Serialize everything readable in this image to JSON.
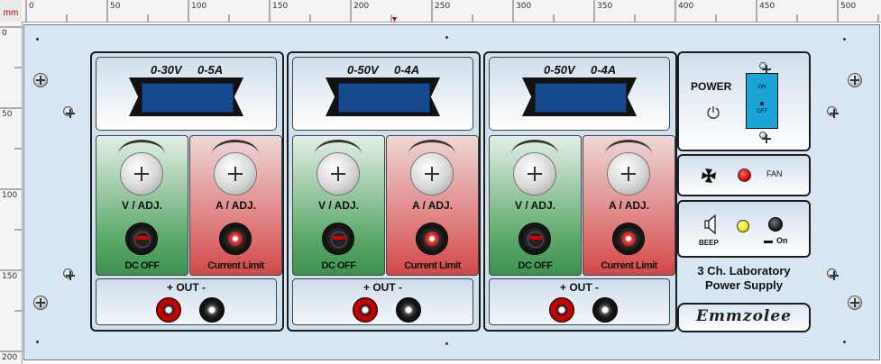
{
  "ruler": {
    "unit": "mm",
    "top_ticks": [
      "0",
      "50",
      "100",
      "150",
      "200",
      "250",
      "300",
      "350",
      "400",
      "450",
      "500"
    ],
    "left_ticks": [
      "0",
      "50",
      "100",
      "150",
      "200"
    ]
  },
  "channels": [
    {
      "voltage": "0-30V",
      "current": "0-5A",
      "v_knob": "V / ADJ.",
      "a_knob": "A / ADJ.",
      "dc_off": "DC OFF",
      "current_limit": "Current Limit",
      "out": "+ OUT -"
    },
    {
      "voltage": "0-50V",
      "current": "0-4A",
      "v_knob": "V / ADJ.",
      "a_knob": "A / ADJ.",
      "dc_off": "DC OFF",
      "current_limit": "Current Limit",
      "out": "+ OUT -"
    },
    {
      "voltage": "0-50V",
      "current": "0-4A",
      "v_knob": "V / ADJ.",
      "a_knob": "A / ADJ.",
      "dc_off": "DC OFF",
      "current_limit": "Current Limit",
      "out": "+ OUT -"
    }
  ],
  "power": {
    "label": "POWER",
    "switch_on": "ON",
    "switch_off": "OFF"
  },
  "fan": {
    "label": "FAN"
  },
  "beep": {
    "label": "BEEP",
    "on_label": "On"
  },
  "title": {
    "line1": "3 Ch. Laboratory",
    "line2": "Power Supply"
  },
  "brand": {
    "name": "Emmzolee"
  },
  "colors": {
    "panel": "#d7e6f2",
    "lcd": "#154a8c",
    "fan_led": "#e00000",
    "beep_led": "#f2e600",
    "power_switch": "#1aa5d6"
  }
}
